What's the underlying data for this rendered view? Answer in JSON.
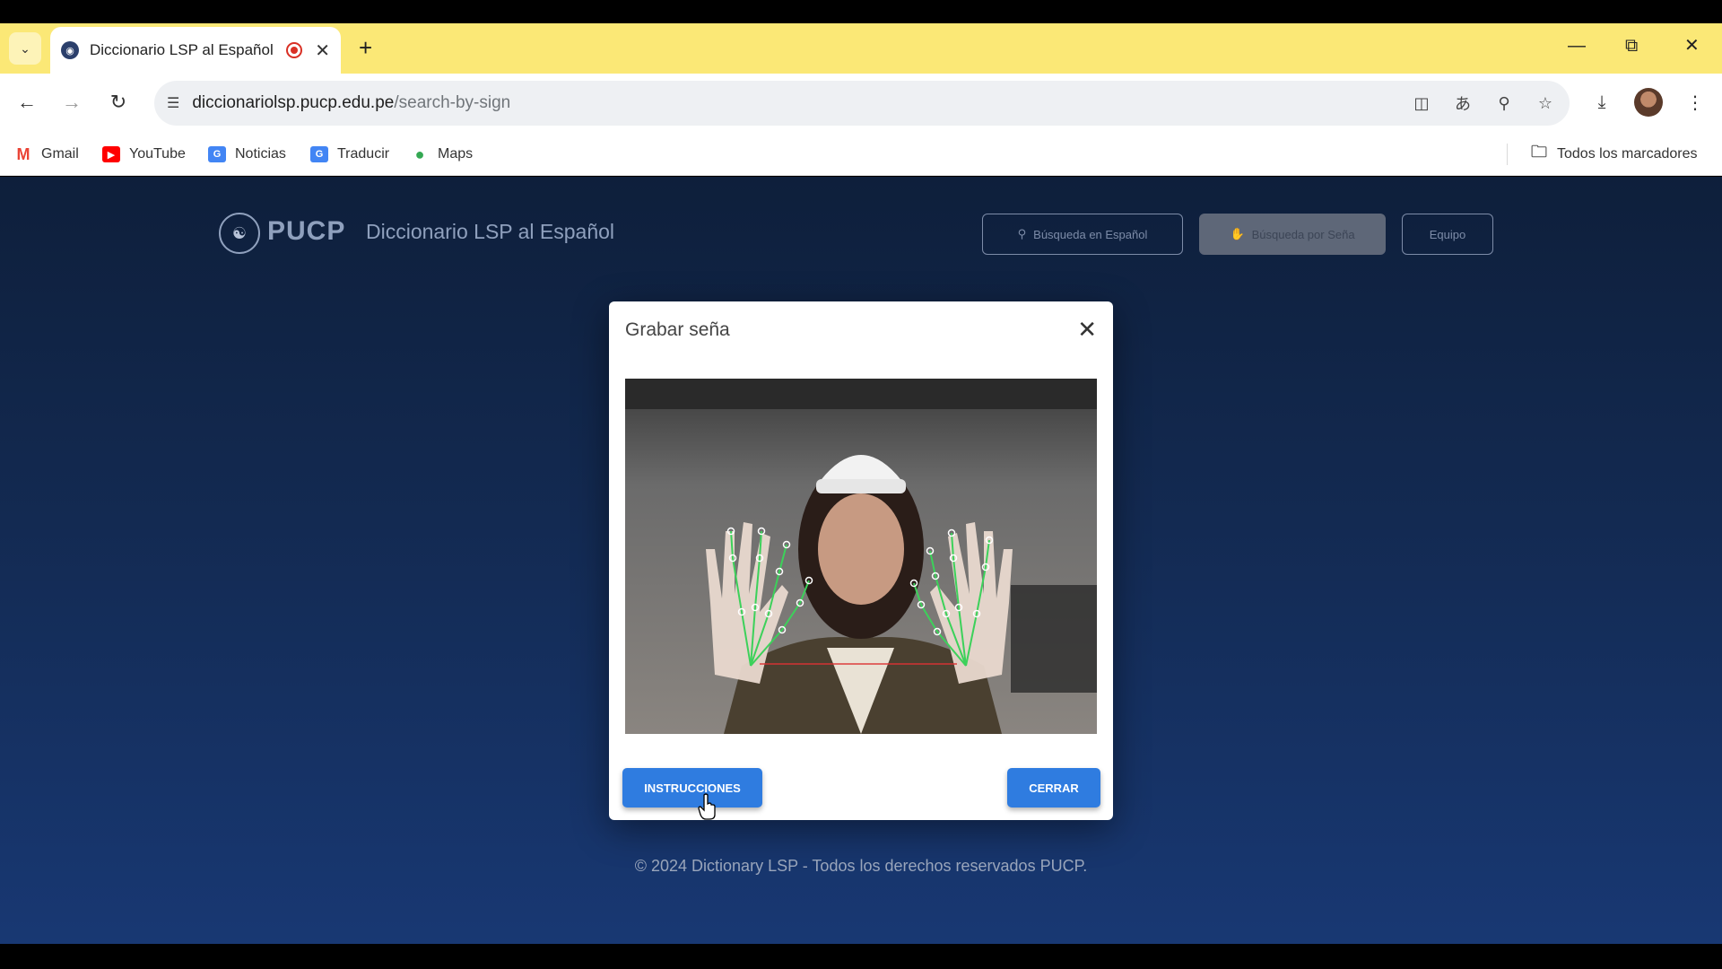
{
  "browser": {
    "tab": {
      "title": "Diccionario LSP al Español",
      "favicon": "pucp-favicon"
    },
    "url": {
      "host": "diccionariolsp.pucp.edu.pe",
      "path": "/search-by-sign"
    },
    "bookmarks": [
      {
        "label": "Gmail",
        "icon": "gmail-icon",
        "color": "#ea4335"
      },
      {
        "label": "YouTube",
        "icon": "youtube-icon",
        "color": "#ff0000"
      },
      {
        "label": "Noticias",
        "icon": "news-icon",
        "color": "#4285f4"
      },
      {
        "label": "Traducir",
        "icon": "translate-icon",
        "color": "#4285f4"
      },
      {
        "label": "Maps",
        "icon": "maps-icon",
        "color": "#34a853"
      }
    ],
    "all_bookmarks": "Todos los marcadores"
  },
  "site": {
    "brand": "PUCP",
    "title": "Diccionario LSP al Español",
    "nav": {
      "spanish_search": "Búsqueda en Español",
      "sign_search": "Búsqueda por Seña",
      "team": "Equipo"
    },
    "footer": "© 2024 Dictionary LSP - Todos los derechos reservados PUCP."
  },
  "modal": {
    "title": "Grabar seña",
    "instructions_button": "INSTRUCCIONES",
    "close_button": "CERRAR"
  },
  "colors": {
    "tabstrip": "#fbe876",
    "page_bg": "#132a52",
    "primary_button": "#2f7ce0"
  }
}
